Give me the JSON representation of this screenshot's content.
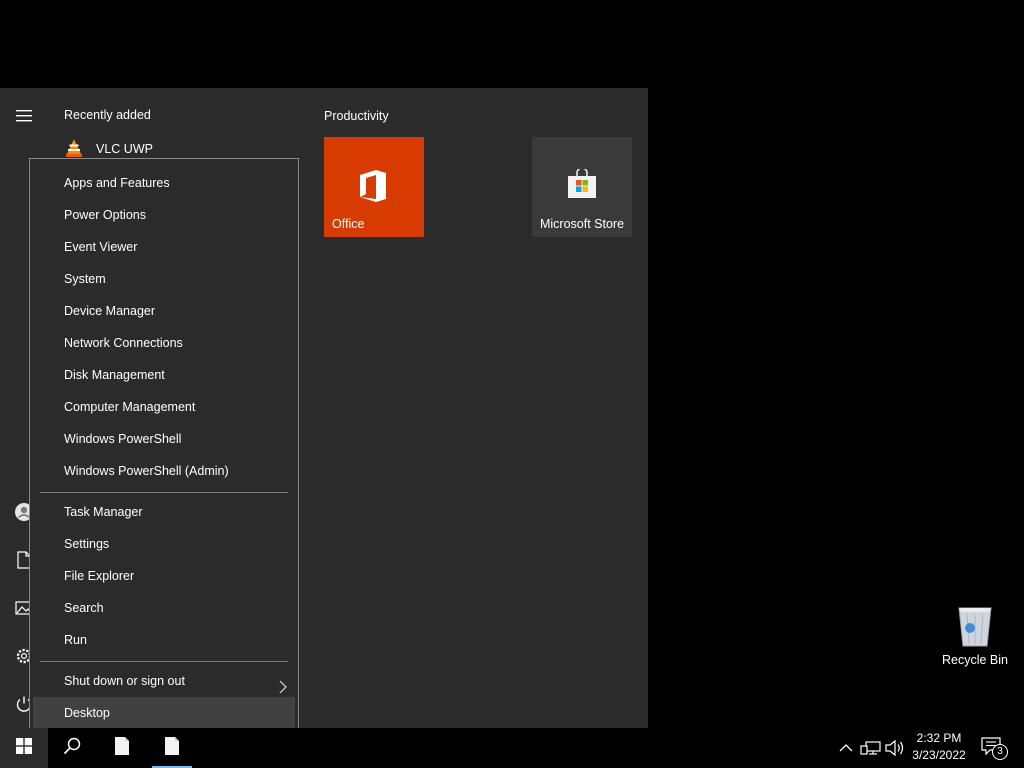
{
  "start_menu": {
    "recent_header": "Recently added",
    "recent_apps": [
      {
        "label": "VLC UWP",
        "icon": "vlc-cone-icon"
      }
    ],
    "tile_group_header": "Productivity",
    "tiles": [
      {
        "label": "Office",
        "color": "#d83b01",
        "icon": "office-icon"
      },
      {
        "label": "Microsoft Store",
        "color": "#3a3a3a",
        "icon": "store-bag-icon"
      }
    ],
    "rail_icons": [
      "hamburger-icon",
      "user-icon",
      "documents-icon",
      "pictures-icon",
      "settings-icon",
      "power-icon"
    ]
  },
  "winx_menu": {
    "group1": [
      "Apps and Features",
      "Power Options",
      "Event Viewer",
      "System",
      "Device Manager",
      "Network Connections",
      "Disk Management",
      "Computer Management",
      "Windows PowerShell",
      "Windows PowerShell (Admin)"
    ],
    "group2": [
      "Task Manager",
      "Settings",
      "File Explorer",
      "Search",
      "Run"
    ],
    "group3": [
      "Shut down or sign out",
      "Desktop"
    ],
    "hovered_item": "Desktop"
  },
  "desktop": {
    "icons": [
      {
        "label": "Recycle Bin",
        "icon": "recycle-bin-icon"
      }
    ]
  },
  "taskbar": {
    "clock_time": "2:32 PM",
    "clock_date": "3/23/2022",
    "notification_count": "3",
    "accent_color": "#76b9ed"
  }
}
